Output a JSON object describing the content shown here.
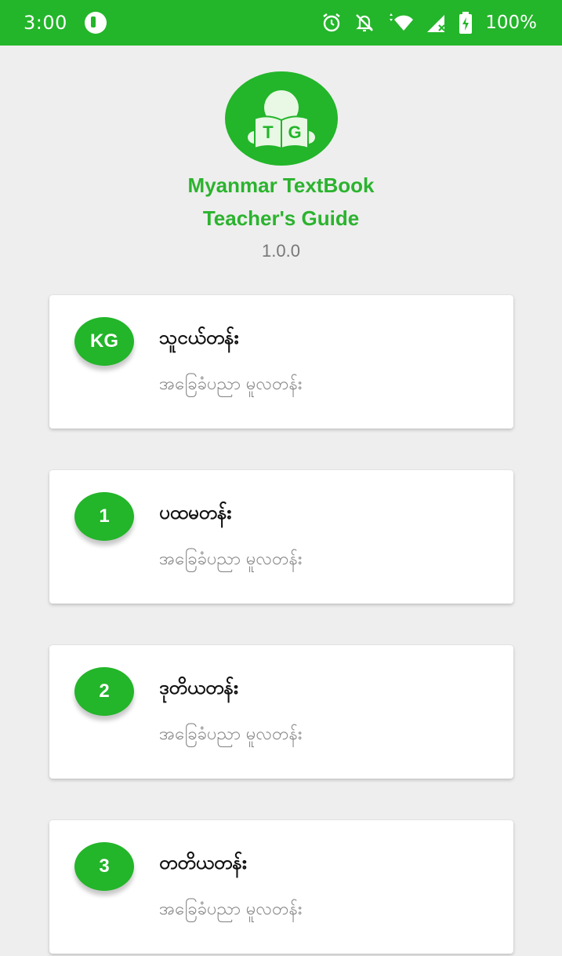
{
  "status_bar": {
    "time": "3:00",
    "battery": "100%",
    "icons": [
      "app-notification-icon",
      "alarm-icon",
      "silent-bell-icon",
      "wifi-icon",
      "cell-signal-icon",
      "battery-charging-icon"
    ]
  },
  "header": {
    "logo_letters": "TG",
    "title_line1": "Myanmar TextBook",
    "title_line2": "Teacher's Guide",
    "version": "1.0.0"
  },
  "colors": {
    "accent": "#23b52a",
    "title_green": "#2bb32e",
    "background": "#eeeeee"
  },
  "grades": [
    {
      "badge": "KG",
      "title": "သူငယ်တန်း",
      "subtitle": "အခြေခံပညာ မူလတန်း"
    },
    {
      "badge": "1",
      "title": "ပထမတန်း",
      "subtitle": "အခြေခံပညာ မူလတန်း"
    },
    {
      "badge": "2",
      "title": "ဒုတိယတန်း",
      "subtitle": "အခြေခံပညာ မူလတန်း"
    },
    {
      "badge": "3",
      "title": "တတိယတန်း",
      "subtitle": "အခြေခံပညာ မူလတန်း"
    }
  ]
}
